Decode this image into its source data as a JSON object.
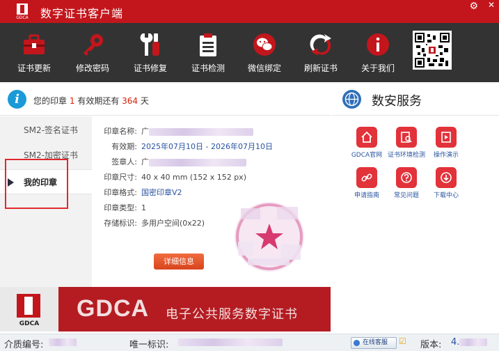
{
  "window": {
    "title": "数字证书客户端",
    "logo_text": "GDCA"
  },
  "toolbar": {
    "items": [
      {
        "label": "证书更新",
        "icon": "toolbox-icon"
      },
      {
        "label": "修改密码",
        "icon": "key-icon"
      },
      {
        "label": "证书修复",
        "icon": "wrench-icon"
      },
      {
        "label": "证书检测",
        "icon": "clipboard-icon"
      },
      {
        "label": "微信绑定",
        "icon": "wechat-icon"
      },
      {
        "label": "刷新证书",
        "icon": "refresh-icon"
      },
      {
        "label": "关于我们",
        "icon": "info-icon"
      }
    ]
  },
  "info": {
    "prefix": "您的印章",
    "count": "1",
    "middle": "有效期还有",
    "days": "364",
    "suffix": "天"
  },
  "sidebar": {
    "items": [
      {
        "label": "SM2-签名证书"
      },
      {
        "label": "SM2-加密证书"
      },
      {
        "label": "我的印章"
      }
    ],
    "active_index": 2
  },
  "seal_detail": {
    "name_label": "印章名称:",
    "name_value": "广",
    "validity_label": "有效期:",
    "validity_value": "2025年07月10日 - 2026年07月10日",
    "signer_label": "签章人:",
    "signer_value": "广",
    "size_label": "印章尺寸:",
    "size_value": "40 x 40 mm (152 x 152 px)",
    "format_label": "印章格式:",
    "format_value": "国密印章V2",
    "type_label": "印章类型:",
    "type_value": "1",
    "storage_label": "存储标识:",
    "storage_value": "多用户空间(0x22)",
    "button_label": "详细信息"
  },
  "services": {
    "title": "数安服务",
    "items": [
      {
        "label": "GDCA官网",
        "icon": "home-icon"
      },
      {
        "label": "证书环境检测",
        "icon": "search-doc-icon"
      },
      {
        "label": "操作演示",
        "icon": "film-icon"
      },
      {
        "label": "申请指南",
        "icon": "link-icon"
      },
      {
        "label": "常见问题",
        "icon": "question-icon"
      },
      {
        "label": "下载中心",
        "icon": "download-icon"
      }
    ]
  },
  "banner": {
    "logo_text": "GDCA",
    "brand": "GDCA",
    "slogan": "电子公共服务数字证书"
  },
  "status": {
    "quality_label": "介质编号:",
    "unique_label": "唯一标识:",
    "chat_label": "在线客服",
    "version_label": "版本:",
    "version_value": "4."
  },
  "colors": {
    "brand_red": "#c3161c",
    "toolbar_dark": "#333334",
    "accent_blue": "#1a9ad7",
    "highlight_red": "#d81e06"
  }
}
